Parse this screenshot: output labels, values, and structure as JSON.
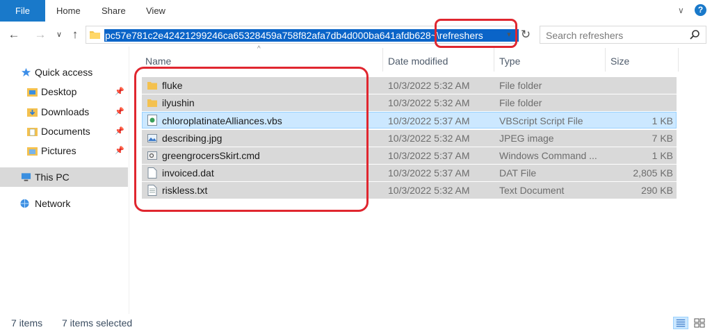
{
  "ribbon": {
    "file": "File",
    "home": "Home",
    "share": "Share",
    "view": "View",
    "help": "?",
    "collapse": "∨"
  },
  "nav": {
    "back": "←",
    "forward": "→",
    "recent": "∨",
    "up": "↑",
    "address_text": "pc57e781c2e42421299246ca65328459a758f82afa7db4d000ba641afdb628~\\refreshers",
    "refresh": "↻",
    "search_placeholder": "Search refreshers"
  },
  "sidebar": {
    "items": [
      {
        "label": "Quick access",
        "icon": "star-icon"
      },
      {
        "label": "Desktop",
        "icon": "desktop-folder-icon",
        "pinned": true
      },
      {
        "label": "Downloads",
        "icon": "downloads-folder-icon",
        "pinned": true
      },
      {
        "label": "Documents",
        "icon": "documents-folder-icon",
        "pinned": true
      },
      {
        "label": "Pictures",
        "icon": "pictures-folder-icon",
        "pinned": true
      },
      {
        "label": "This PC",
        "icon": "pc-icon",
        "selected": true
      },
      {
        "label": "Network",
        "icon": "network-icon"
      }
    ],
    "pin_glyph": "📌"
  },
  "columns": {
    "name": "Name",
    "date": "Date modified",
    "type": "Type",
    "size": "Size"
  },
  "files": [
    {
      "name": "fluke",
      "date": "10/3/2022 5:32 AM",
      "type": "File folder",
      "size": "",
      "icon": "folder-icon"
    },
    {
      "name": "ilyushin",
      "date": "10/3/2022 5:32 AM",
      "type": "File folder",
      "size": "",
      "icon": "folder-icon"
    },
    {
      "name": "chloroplatinateAlliances.vbs",
      "date": "10/3/2022 5:37 AM",
      "type": "VBScript Script File",
      "size": "1 KB",
      "icon": "vbs-file-icon"
    },
    {
      "name": "describing.jpg",
      "date": "10/3/2022 5:32 AM",
      "type": "JPEG image",
      "size": "7 KB",
      "icon": "image-file-icon"
    },
    {
      "name": "greengrocersSkirt.cmd",
      "date": "10/3/2022 5:37 AM",
      "type": "Windows Command ...",
      "size": "1 KB",
      "icon": "cmd-file-icon"
    },
    {
      "name": "invoiced.dat",
      "date": "10/3/2022 5:37 AM",
      "type": "DAT File",
      "size": "2,805 KB",
      "icon": "blank-file-icon"
    },
    {
      "name": "riskless.txt",
      "date": "10/3/2022 5:32 AM",
      "type": "Text Document",
      "size": "290 KB",
      "icon": "text-file-icon"
    }
  ],
  "status": {
    "count": "7 items",
    "selected": "7 items selected"
  },
  "colors": {
    "accent": "#1979ca",
    "selection": "#d9d9d9",
    "focus": "#cce8ff",
    "annotation": "#e0262f"
  }
}
